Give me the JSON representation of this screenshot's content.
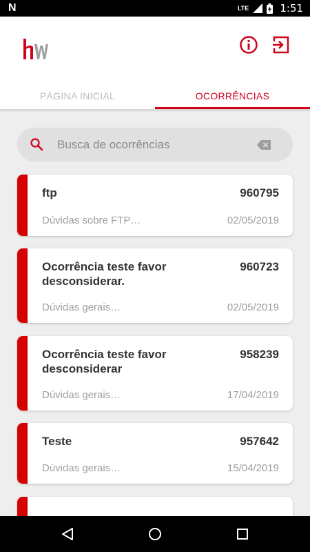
{
  "status_bar": {
    "time": "1:51",
    "network": "LTE"
  },
  "header": {
    "logo": "hw",
    "tabs": [
      {
        "label": "PÁGINA INICIAL",
        "active": false
      },
      {
        "label": "OCORRÊNCIAS",
        "active": true
      }
    ]
  },
  "search": {
    "placeholder": "Busca de ocorrências",
    "value": ""
  },
  "occurrences": [
    {
      "title": "ftp",
      "number": "960795",
      "subject": "Dúvidas sobre FTP…",
      "date": "02/05/2019"
    },
    {
      "title": "Ocorrência teste favor desconsiderar.",
      "number": "960723",
      "subject": "Dúvidas gerais…",
      "date": "02/05/2019"
    },
    {
      "title": "Ocorrência teste favor desconsiderar",
      "number": "958239",
      "subject": "Dúvidas gerais…",
      "date": "17/04/2019"
    },
    {
      "title": "Teste",
      "number": "957642",
      "subject": "Dúvidas gerais…",
      "date": "15/04/2019"
    }
  ],
  "icons": [
    "info-icon",
    "logout-icon",
    "search-icon",
    "clear-icon",
    "back-icon",
    "home-icon",
    "recents-icon"
  ],
  "colors": {
    "accent": "#d0021b",
    "card_bar": "#d50000",
    "background": "#eeeeee"
  }
}
